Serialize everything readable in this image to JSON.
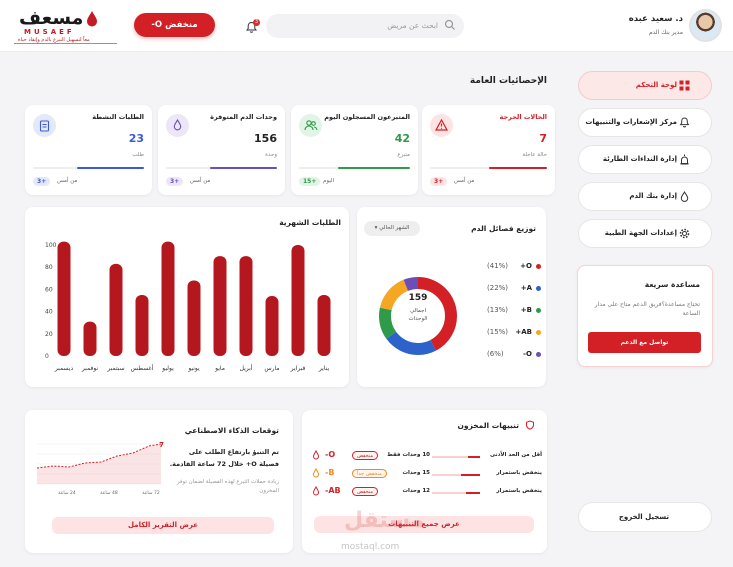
{
  "header": {
    "user_name": "د. سعيد عبده",
    "user_role": "مدير بنك الدم",
    "search_placeholder": "ابحث عن مريض",
    "notification_count": "3",
    "alert_button_label": "منخفض O-",
    "logo_ar": "مسعف",
    "logo_en": "MUSAEF",
    "logo_tagline": "معاً لتسهيل التبرع بالدم وإنقاذ حياة"
  },
  "sidebar": {
    "items": [
      {
        "label": "لوحة التحكم",
        "icon": "grid-icon",
        "active": true
      },
      {
        "label": "مركز الإشعارات والتنبيهات",
        "icon": "bell-icon",
        "active": false
      },
      {
        "label": "إدارة النداءات الطارئة",
        "icon": "siren-icon",
        "active": false
      },
      {
        "label": "إدارة بنك الدم",
        "icon": "blood-drop-icon",
        "active": false
      },
      {
        "label": "إعدادات الجهة الطبية",
        "icon": "gear-icon",
        "active": false
      }
    ],
    "help": {
      "title": "مساعدة سريعة",
      "text": "تحتاج مساعدة؟فريق الدعم متاح على مدار الساعة",
      "button": "تواصل مع الدعم"
    },
    "logout": "تسجيل الخروج"
  },
  "stats": {
    "section_title": "الإحصائيات العامة",
    "cards": [
      {
        "title": "الحالات الحرجة",
        "value": "7",
        "unit": "حالة عاجلة",
        "delta": "+3",
        "since": "من أمس",
        "color": "#d32027",
        "progress": 0.5
      },
      {
        "title": "المتبرعون المسجلون اليوم",
        "value": "42",
        "unit": "متبرع",
        "delta": "+15",
        "since": "اليوم",
        "color": "#2f9a49",
        "progress": 0.65
      },
      {
        "title": "وحدات الدم المتوفرة",
        "value": "156",
        "unit": "وحدة",
        "delta": "+3",
        "since": "من أمس",
        "color": "#6a4fb8",
        "progress": 0.6
      },
      {
        "title": "الطلبات النشطة",
        "value": "23",
        "unit": "طلب",
        "delta": "+3",
        "since": "من أمس",
        "color": "#3b5bd6",
        "progress": 0.6
      }
    ]
  },
  "donut": {
    "title": "توزيع فصائل الدم",
    "filter": "الشهر الحالي",
    "center_value": "159",
    "center_label": "اجمالي الوحدات",
    "legend": [
      {
        "name": "O+",
        "pct": "(41%)",
        "value": 41,
        "color": "#d32027"
      },
      {
        "name": "A+",
        "pct": "(22%)",
        "value": 22,
        "color": "#2c62c9"
      },
      {
        "name": "B+",
        "pct": "(13%)",
        "value": 13,
        "color": "#2f9a49"
      },
      {
        "name": "AB+",
        "pct": "(15%)",
        "value": 15,
        "color": "#f5a623"
      },
      {
        "name": "O-",
        "pct": "(6%)",
        "value": 6,
        "color": "#6a4fb8"
      }
    ]
  },
  "chart_data": {
    "type": "bar",
    "title": "الطلبات الشهرية",
    "categories": [
      "يناير",
      "فبراير",
      "مارس",
      "أبريل",
      "مايو",
      "يونيو",
      "يوليو",
      "أغسطس",
      "سبتمبر",
      "نوفمبر",
      "ديسمبر"
    ],
    "values": [
      55,
      100,
      54,
      90,
      90,
      68,
      103,
      55,
      83,
      31,
      103
    ],
    "ylim": [
      0,
      100
    ],
    "yticks": [
      "0",
      "20",
      "40",
      "60",
      "80",
      "100"
    ],
    "color": "#b5171f"
  },
  "inventory": {
    "title": "تنبيهات المخزون",
    "rows": [
      {
        "label": "أقل من الحد الأدنى",
        "units": "10 وحدات فقط",
        "badge": "منخفض",
        "type": "O-",
        "level": 0.25
      },
      {
        "label": "ينخفض باستمرار",
        "units": "15 وحدات",
        "badge": "منخفض جداً",
        "type": "B-",
        "level": 0.4
      },
      {
        "label": "ينخفض باستمرار",
        "units": "12 وحدات",
        "badge": "منخفض",
        "type": "AB-",
        "level": 0.3
      }
    ],
    "button": "عرض جميع التنبيهات"
  },
  "ai": {
    "title": "توقعات الذكاء الاصطناعي",
    "headline": "تم التنبؤ بارتفاع الطلب على فصيلة O+ خلال 72 ساعة القادمة.",
    "sub": "زيادة حملات التبرع لهذه الفصيلة لضمان توفر المخزون",
    "chart_labels": [
      "24 ساعة",
      "48 ساعة",
      "72 ساعة"
    ],
    "chart_peak": "7",
    "button": "عرض التقرير الكامل"
  },
  "watermark": {
    "ar": "مستقل",
    "en": "mostaql.com"
  }
}
